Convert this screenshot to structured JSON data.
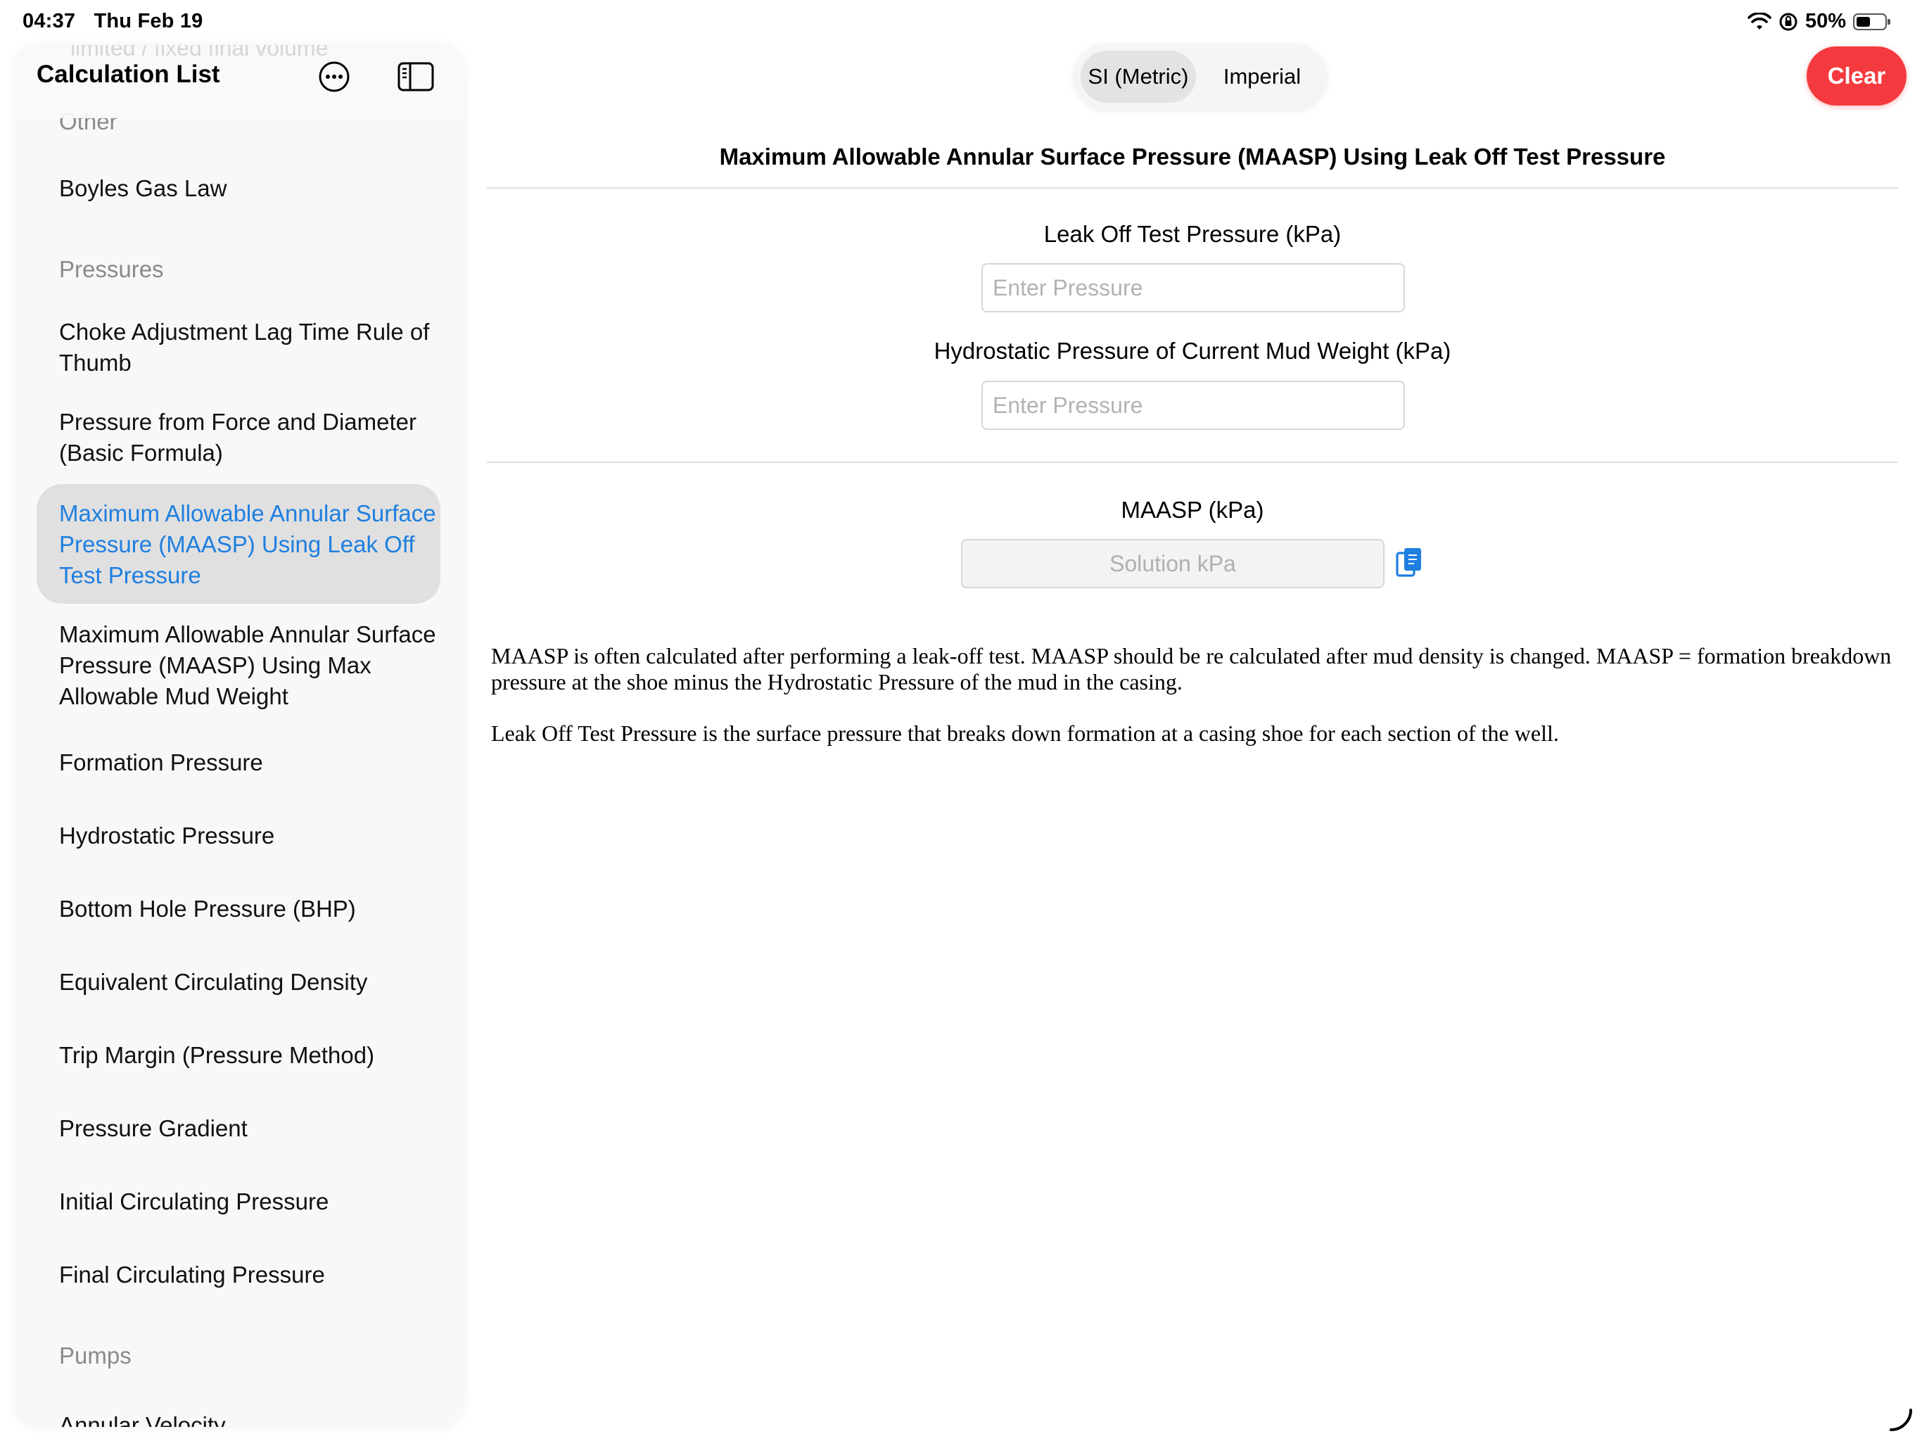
{
  "status_bar": {
    "time": "04:37",
    "date": "Thu Feb 19",
    "battery_percent": "50%",
    "battery_level": 0.5
  },
  "sidebar": {
    "title": "Calculation List",
    "ghost_item": "limited / fixed final volume",
    "more_icon": "ellipsis-circle-icon",
    "toggle_icon": "sidebar-toggle-icon",
    "sections": {
      "other": "Other",
      "pressures": "Pressures",
      "pumps": "Pumps"
    },
    "items": [
      "Boyles Gas Law",
      "Choke Adjustment Lag Time Rule of Thumb",
      "Pressure from Force and Diameter (Basic Formula)",
      "Maximum Allowable Annular Surface Pressure (MAASP) Using Leak Off Test Pressure",
      "Maximum Allowable Annular Surface Pressure (MAASP) Using Max Allowable Mud Weight",
      "Formation Pressure",
      "Hydrostatic Pressure",
      "Bottom Hole Pressure (BHP)",
      "Equivalent Circulating Density",
      "Trip Margin (Pressure Method)",
      "Pressure Gradient",
      "Initial Circulating Pressure",
      "Final Circulating Pressure",
      "Annular Velocity"
    ],
    "selected_index": 3
  },
  "toolbar": {
    "units": [
      "SI (Metric)",
      "Imperial"
    ],
    "active_unit": "SI (Metric)",
    "clear_label": "Clear"
  },
  "main": {
    "title": "Maximum Allowable Annular Surface Pressure (MAASP) Using Leak Off Test Pressure",
    "fields": [
      {
        "label": "Leak Off Test Pressure (kPa)",
        "value": "",
        "placeholder": "Enter Pressure"
      },
      {
        "label": "Hydrostatic Pressure of Current Mud Weight (kPa)",
        "value": "",
        "placeholder": "Enter Pressure"
      }
    ],
    "result": {
      "label": "MAASP (kPa)",
      "placeholder": "Solution kPa",
      "copy_icon": "copy-icon"
    },
    "description": [
      "MAASP is often calculated after performing a leak-off test. MAASP should be re calculated after mud density is changed. MAASP = formation breakdown pressure at the shoe minus the Hydrostatic Pressure of the mud in the casing.",
      "Leak Off Test Pressure is the surface pressure that breaks down formation at a casing shoe for each section of the well."
    ]
  },
  "colors": {
    "accent": "#1e7fe0",
    "clear_button": "#f43a3e",
    "selected_row": "#e0e0e0",
    "section_label": "#8a8a8a"
  }
}
